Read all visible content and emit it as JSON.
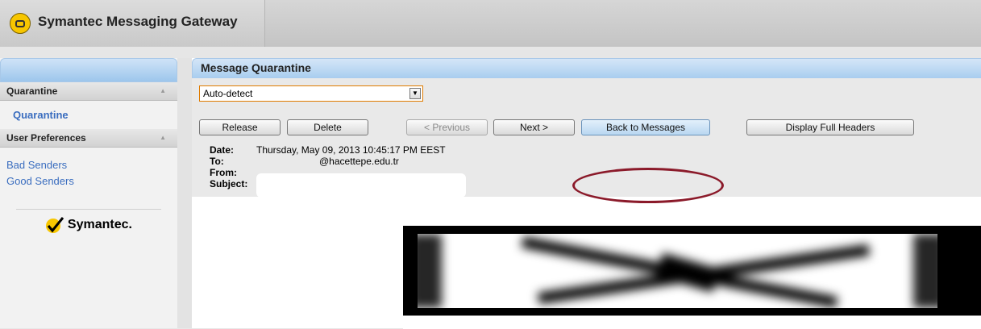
{
  "app": {
    "title": "Symantec Messaging Gateway"
  },
  "sidebar": {
    "sections": [
      {
        "title": "Quarantine",
        "items": [
          "Quarantine"
        ]
      },
      {
        "title": "User Preferences",
        "items": [
          "Bad Senders",
          "Good Senders"
        ]
      }
    ],
    "vendor_logo": "Symantec."
  },
  "main": {
    "title": "Message Quarantine",
    "encoding_select": {
      "value": "Auto-detect"
    },
    "buttons": {
      "release": "Release",
      "delete": "Delete",
      "previous": "< Previous",
      "next": "Next >",
      "back": "Back to Messages",
      "headers": "Display Full Headers"
    },
    "message": {
      "date_label": "Date:",
      "date_value": "Thursday, May 09, 2013 10:45:17 PM EEST",
      "to_label": "To:",
      "to_value": "@hacettepe.edu.tr",
      "from_label": "From:",
      "subject_label": "Subject:"
    }
  },
  "colors": {
    "accent": "#3a6dbf",
    "highlight": "#8b1a2a",
    "select_border": "#e07b00"
  },
  "icons": {
    "logo": "envelope-icon",
    "vendor": "checkmark-icon",
    "dropdown": "chevron-down-icon",
    "section_toggle": "chevron-up-icon"
  }
}
